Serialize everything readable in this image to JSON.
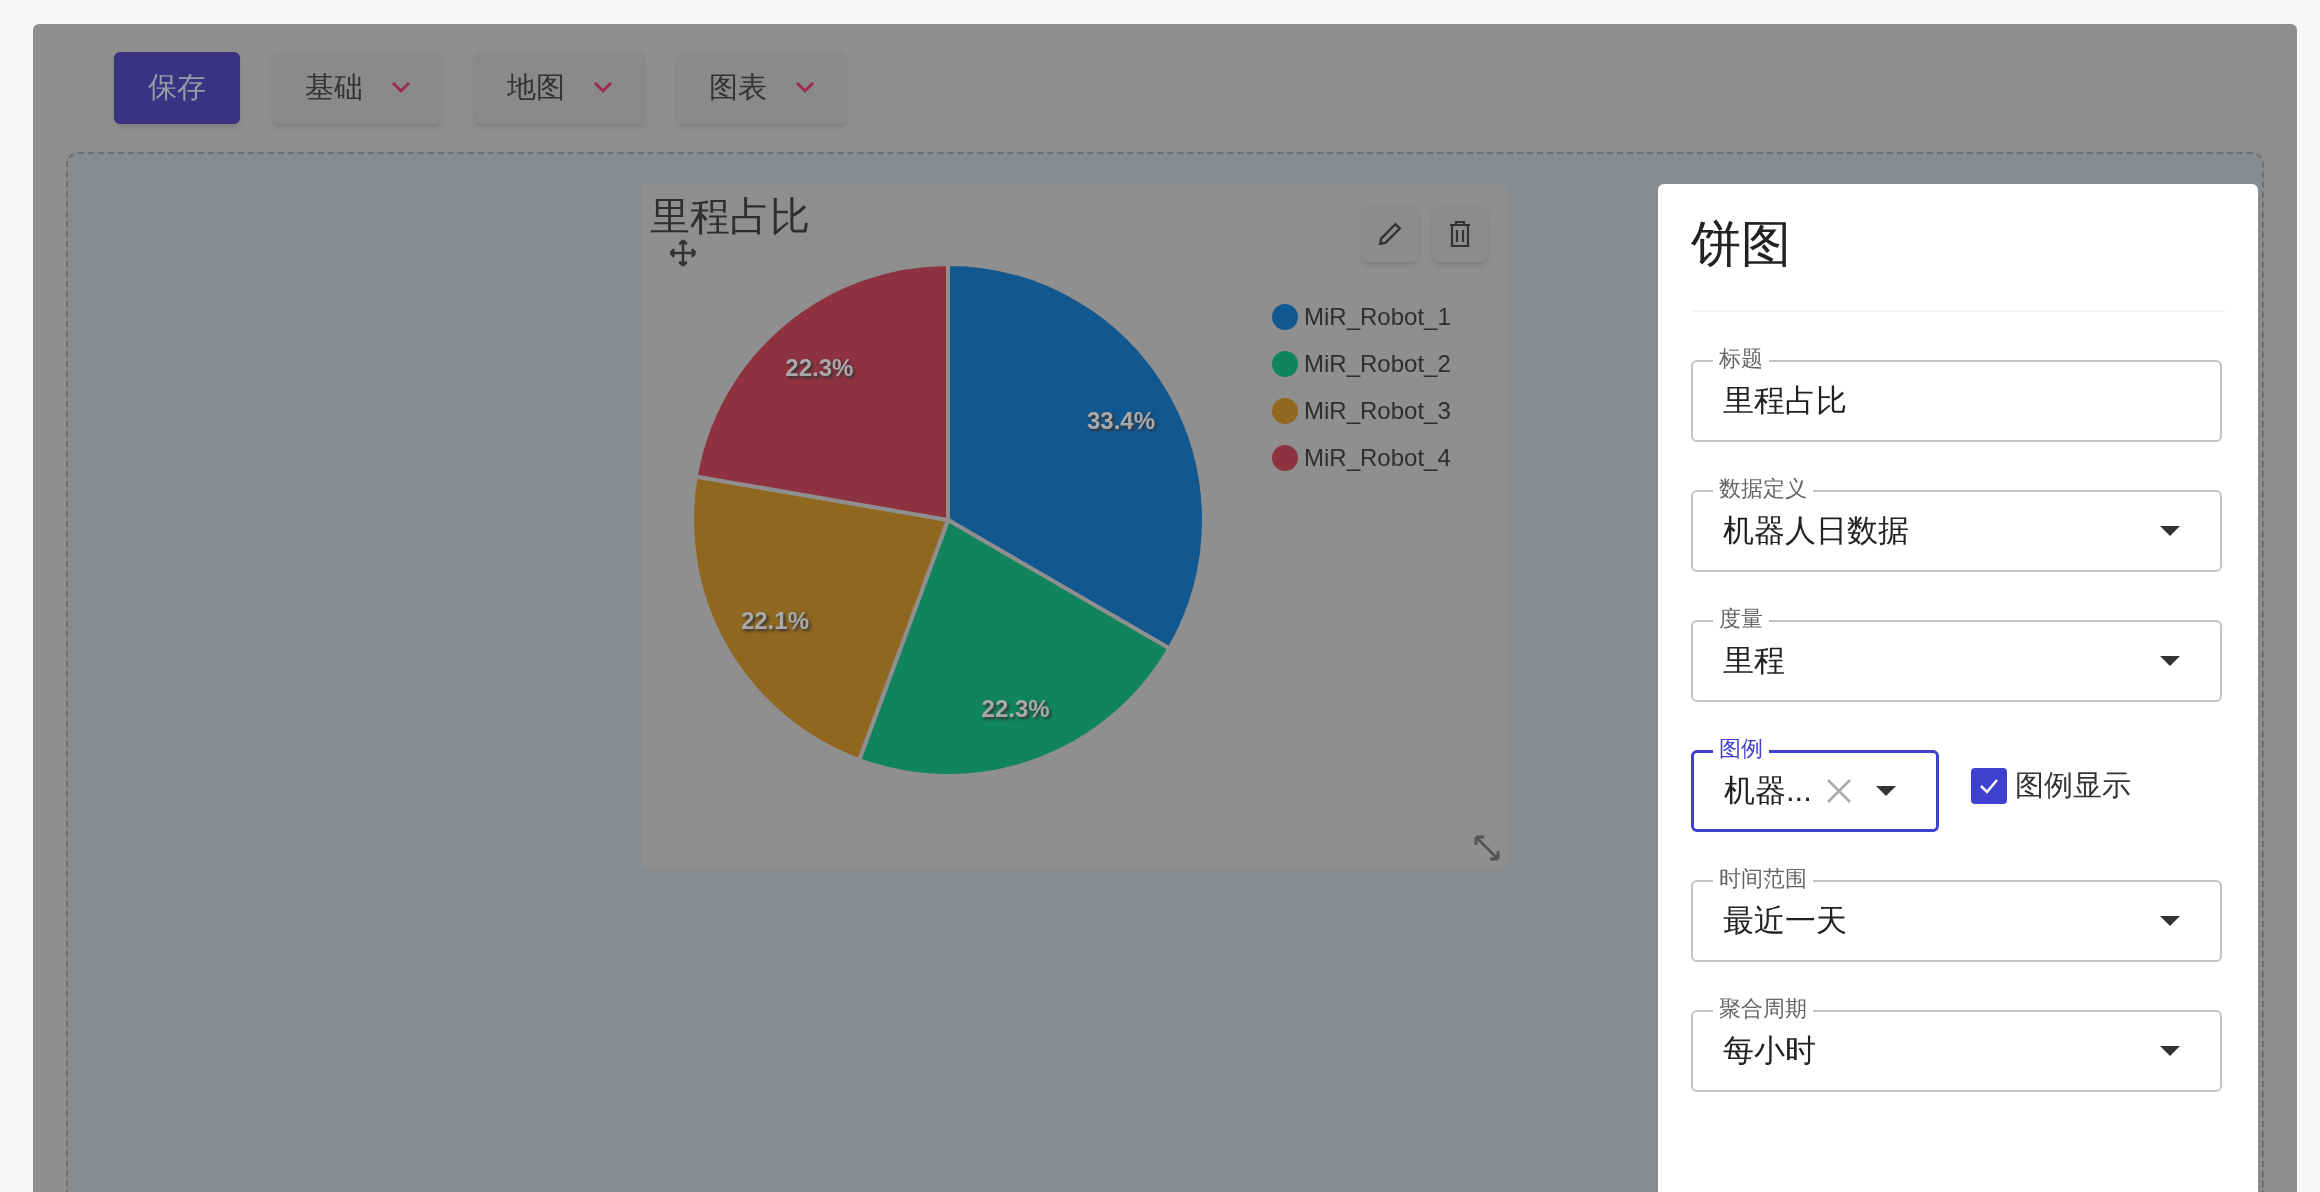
{
  "toolbar": {
    "save_button": "保存",
    "menus": [
      {
        "label": "基础"
      },
      {
        "label": "地图"
      },
      {
        "label": "图表"
      }
    ]
  },
  "widget": {
    "title": "里程占比",
    "legend": [
      {
        "color": "#115790"
      },
      {
        "color": "#10845a"
      },
      {
        "color": "#8f671e"
      },
      {
        "color": "#8e3240"
      }
    ],
    "chart_data": {
      "type": "pie",
      "categories": [
        "MiR_Robot_1",
        "MiR_Robot_2",
        "MiR_Robot_3",
        "MiR_Robot_4"
      ],
      "values": [
        33.4,
        22.3,
        22.1,
        22.3
      ],
      "value_labels": [
        "33.4%",
        "22.3%",
        "22.1%",
        "22.3%"
      ]
    }
  },
  "panel": {
    "title": "饼图",
    "fields": [
      {
        "kind": "text",
        "label": "标题",
        "value": "里程占比"
      },
      {
        "kind": "select",
        "label": "数据定义",
        "value": "机器人日数据"
      },
      {
        "kind": "select",
        "label": "度量",
        "value": "里程"
      },
      {
        "kind": "clearable",
        "label": "图例",
        "value": "机器...",
        "focused": true
      },
      {
        "kind": "select",
        "label": "时间范围",
        "value": "最近一天"
      },
      {
        "kind": "select",
        "label": "聚合周期",
        "value": "每小时"
      }
    ],
    "legend_toggle": {
      "label": "图例显示",
      "checked": true
    }
  }
}
